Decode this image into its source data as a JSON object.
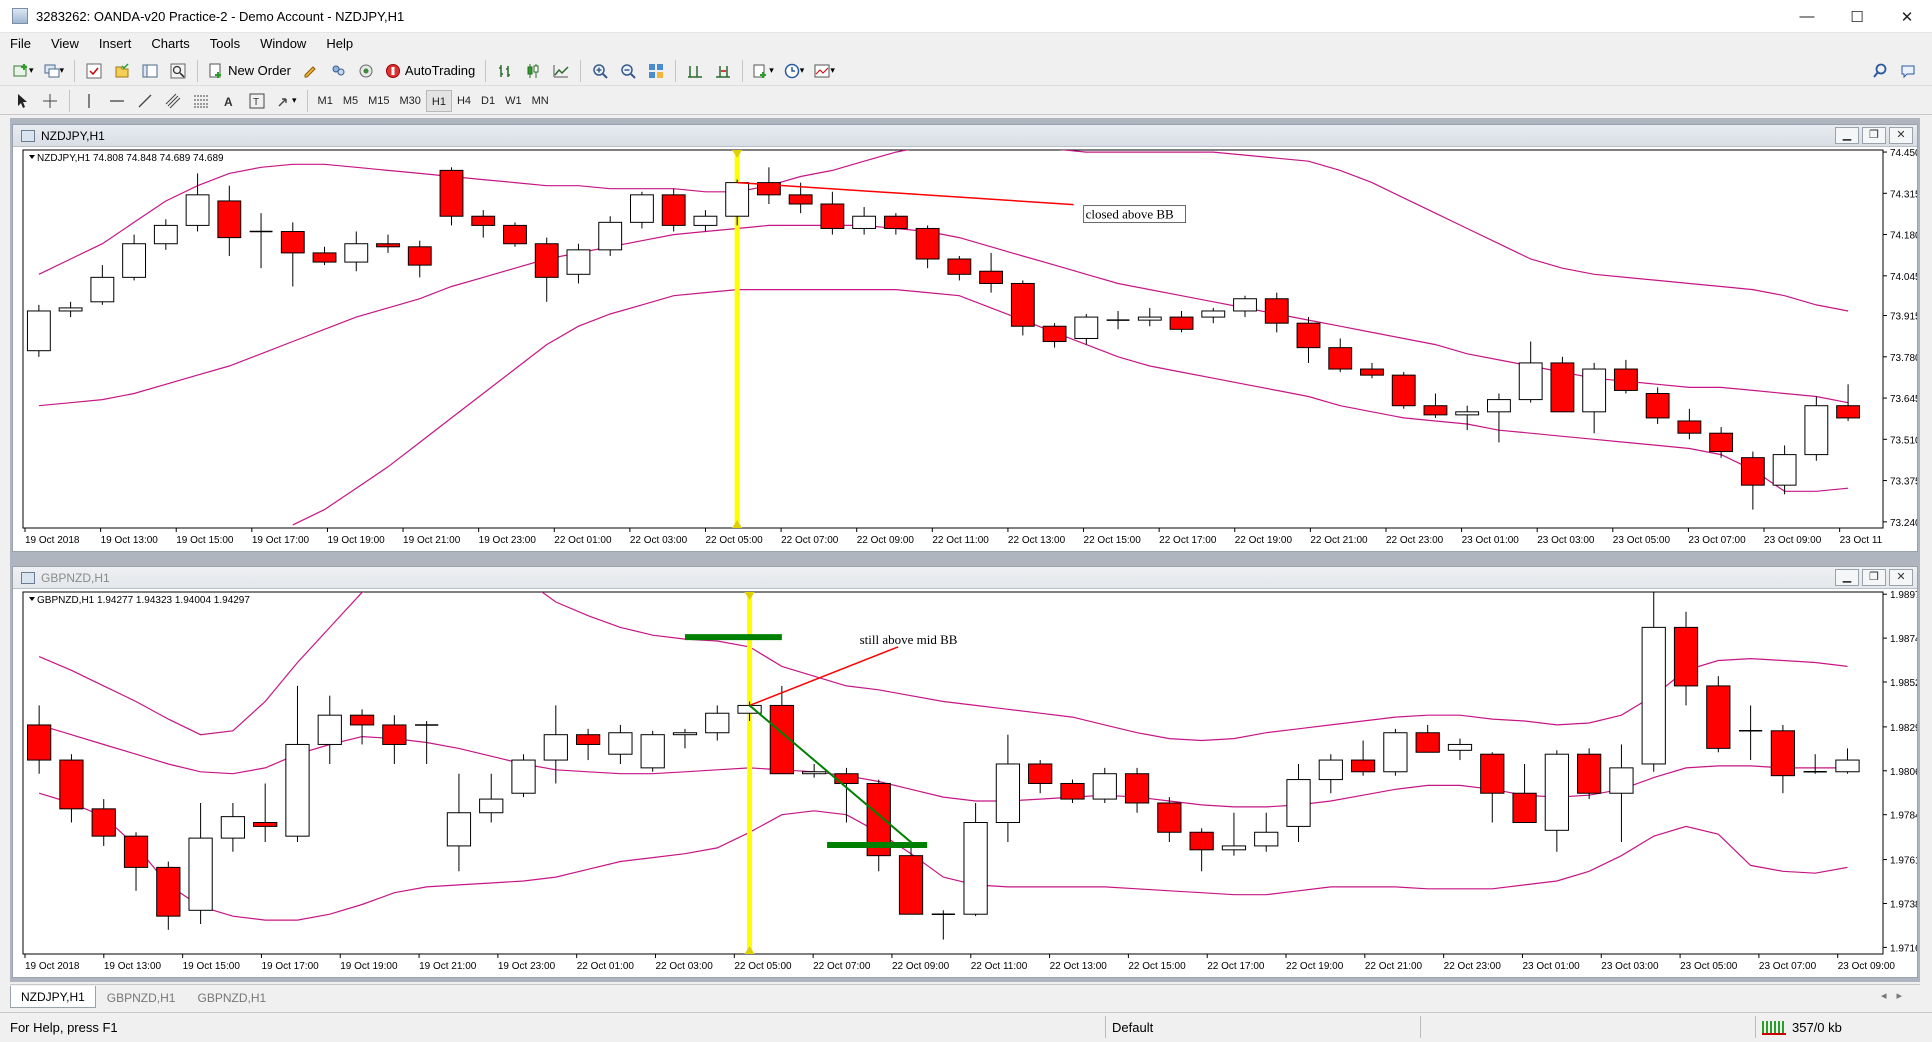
{
  "window": {
    "title": "3283262: OANDA-v20 Practice-2 - Demo Account - NZDJPY,H1",
    "minimize": "—",
    "maximize": "☐",
    "close": "✕"
  },
  "menu": [
    "File",
    "View",
    "Insert",
    "Charts",
    "Tools",
    "Window",
    "Help"
  ],
  "toolbar": {
    "new_order": "New Order",
    "autotrading": "AutoTrading"
  },
  "timeframes": [
    "M1",
    "M5",
    "M15",
    "M30",
    "H1",
    "H4",
    "D1",
    "W1",
    "MN"
  ],
  "active_timeframe": "H1",
  "colors": {
    "bear": "#ff0000",
    "bull": "#ffffff",
    "bands": "#c71585",
    "vline": "#ffff00",
    "annot_red": "#ff0000",
    "annot_green": "#008000"
  },
  "charts": [
    {
      "window_title": "NZDJPY,H1",
      "info": "NZDJPY,H1  74.808 74.848 74.689 74.689",
      "annotation": "closed above BB",
      "y_ticks": [
        "74.450",
        "74.315",
        "74.180",
        "74.045",
        "73.915",
        "73.780",
        "73.645",
        "73.510",
        "73.375",
        "73.240"
      ],
      "x_labels": [
        "19 Oct 2018",
        "19 Oct 13:00",
        "19 Oct 15:00",
        "19 Oct 17:00",
        "19 Oct 19:00",
        "19 Oct 21:00",
        "19 Oct 23:00",
        "22 Oct 01:00",
        "22 Oct 03:00",
        "22 Oct 05:00",
        "22 Oct 07:00",
        "22 Oct 09:00",
        "22 Oct 11:00",
        "22 Oct 13:00",
        "22 Oct 15:00",
        "22 Oct 17:00",
        "22 Oct 19:00",
        "22 Oct 21:00",
        "22 Oct 23:00",
        "23 Oct 01:00",
        "23 Oct 03:00",
        "23 Oct 05:00",
        "23 Oct 07:00",
        "23 Oct 09:00",
        "23 Oct 11"
      ],
      "candles": [
        [
          73.8,
          73.95,
          73.78,
          73.93
        ],
        [
          73.93,
          73.96,
          73.91,
          73.94
        ],
        [
          73.96,
          74.08,
          73.95,
          74.04
        ],
        [
          74.04,
          74.18,
          74.03,
          74.15
        ],
        [
          74.15,
          74.23,
          74.13,
          74.21
        ],
        [
          74.21,
          74.38,
          74.19,
          74.31
        ],
        [
          74.29,
          74.34,
          74.11,
          74.17
        ],
        [
          74.19,
          74.25,
          74.07,
          74.19
        ],
        [
          74.19,
          74.22,
          74.01,
          74.12
        ],
        [
          74.12,
          74.14,
          74.08,
          74.09
        ],
        [
          74.09,
          74.19,
          74.06,
          74.15
        ],
        [
          74.15,
          74.18,
          74.12,
          74.14
        ],
        [
          74.14,
          74.16,
          74.04,
          74.08
        ],
        [
          74.39,
          74.4,
          74.21,
          74.24
        ],
        [
          74.24,
          74.26,
          74.17,
          74.21
        ],
        [
          74.21,
          74.22,
          74.14,
          74.15
        ],
        [
          74.15,
          74.17,
          73.96,
          74.04
        ],
        [
          74.05,
          74.15,
          74.02,
          74.13
        ],
        [
          74.13,
          74.24,
          74.11,
          74.22
        ],
        [
          74.22,
          74.32,
          74.2,
          74.31
        ],
        [
          74.31,
          74.33,
          74.19,
          74.21
        ],
        [
          74.21,
          74.26,
          74.19,
          74.24
        ],
        [
          74.24,
          74.36,
          74.21,
          74.35
        ],
        [
          74.35,
          74.4,
          74.28,
          74.31
        ],
        [
          74.31,
          74.35,
          74.25,
          74.28
        ],
        [
          74.28,
          74.32,
          74.18,
          74.2
        ],
        [
          74.2,
          74.27,
          74.18,
          74.24
        ],
        [
          74.24,
          74.25,
          74.18,
          74.2
        ],
        [
          74.2,
          74.21,
          74.07,
          74.1
        ],
        [
          74.1,
          74.11,
          74.03,
          74.05
        ],
        [
          74.06,
          74.12,
          73.99,
          74.02
        ],
        [
          74.02,
          74.03,
          73.85,
          73.88
        ],
        [
          73.88,
          73.89,
          73.81,
          73.83
        ],
        [
          73.84,
          73.92,
          73.82,
          73.91
        ],
        [
          73.9,
          73.93,
          73.87,
          73.9
        ],
        [
          73.9,
          73.94,
          73.88,
          73.91
        ],
        [
          73.91,
          73.93,
          73.86,
          73.87
        ],
        [
          73.91,
          73.94,
          73.89,
          73.93
        ],
        [
          73.93,
          73.98,
          73.91,
          73.97
        ],
        [
          73.97,
          73.99,
          73.86,
          73.89
        ],
        [
          73.89,
          73.91,
          73.76,
          73.81
        ],
        [
          73.81,
          73.84,
          73.73,
          73.74
        ],
        [
          73.74,
          73.76,
          73.71,
          73.72
        ],
        [
          73.72,
          73.73,
          73.61,
          73.62
        ],
        [
          73.62,
          73.66,
          73.58,
          73.59
        ],
        [
          73.59,
          73.62,
          73.54,
          73.6
        ],
        [
          73.6,
          73.66,
          73.5,
          73.64
        ],
        [
          73.64,
          73.83,
          73.63,
          73.76
        ],
        [
          73.76,
          73.78,
          73.6,
          73.6
        ],
        [
          73.6,
          73.76,
          73.53,
          73.74
        ],
        [
          73.74,
          73.77,
          73.66,
          73.67
        ],
        [
          73.66,
          73.68,
          73.56,
          73.58
        ],
        [
          73.57,
          73.61,
          73.51,
          73.53
        ],
        [
          73.53,
          73.55,
          73.45,
          73.47
        ],
        [
          73.45,
          73.47,
          73.28,
          73.36
        ],
        [
          73.36,
          73.49,
          73.33,
          73.46
        ],
        [
          73.46,
          73.65,
          73.44,
          73.62
        ],
        [
          73.62,
          73.69,
          73.57,
          73.58
        ]
      ],
      "bb_upper": [
        74.05,
        74.1,
        74.15,
        74.22,
        74.29,
        74.34,
        74.38,
        74.4,
        74.41,
        74.41,
        74.4,
        74.39,
        74.38,
        74.37,
        74.36,
        74.35,
        74.34,
        74.34,
        74.33,
        74.33,
        74.33,
        74.32,
        74.32,
        74.34,
        74.37,
        74.39,
        74.42,
        74.45,
        74.47,
        74.47,
        74.47,
        74.47,
        74.46,
        74.45,
        74.45,
        74.45,
        74.45,
        74.45,
        74.44,
        74.43,
        74.42,
        74.39,
        74.35,
        74.3,
        74.25,
        74.2,
        74.15,
        74.1,
        74.07,
        74.05,
        74.04,
        74.03,
        74.02,
        74.01,
        74.0,
        73.98,
        73.95,
        73.93
      ],
      "bb_mid": [
        73.62,
        73.63,
        73.64,
        73.66,
        73.69,
        73.72,
        73.75,
        73.79,
        73.83,
        73.87,
        73.91,
        73.94,
        73.97,
        74.01,
        74.04,
        74.07,
        74.1,
        74.12,
        74.14,
        74.16,
        74.18,
        74.19,
        74.2,
        74.21,
        74.21,
        74.21,
        74.21,
        74.2,
        74.19,
        74.17,
        74.14,
        74.11,
        74.08,
        74.05,
        74.02,
        74.0,
        73.98,
        73.96,
        73.94,
        73.92,
        73.9,
        73.88,
        73.86,
        73.84,
        73.82,
        73.79,
        73.77,
        73.75,
        73.73,
        73.71,
        73.7,
        73.69,
        73.68,
        73.68,
        73.67,
        73.66,
        73.65,
        73.63
      ],
      "bb_lower": [
        null,
        null,
        null,
        null,
        null,
        null,
        null,
        null,
        73.23,
        73.28,
        73.35,
        73.42,
        73.5,
        73.58,
        73.66,
        73.74,
        73.82,
        73.88,
        73.92,
        73.95,
        73.98,
        73.99,
        74.0,
        74.0,
        74.0,
        74.0,
        74.0,
        74.0,
        73.99,
        73.98,
        73.94,
        73.9,
        73.86,
        73.82,
        73.78,
        73.75,
        73.73,
        73.71,
        73.69,
        73.67,
        73.65,
        73.62,
        73.6,
        73.58,
        73.57,
        73.56,
        73.54,
        73.53,
        73.52,
        73.51,
        73.5,
        73.49,
        73.48,
        73.46,
        73.41,
        73.34,
        73.34,
        73.35
      ],
      "marked_index": 22,
      "annot_line_from_index": 22,
      "annot_line_to_index": 32
    },
    {
      "window_title": "GBPNZD,H1",
      "info": "GBPNZD,H1  1.94277 1.94323 1.94004 1.94297",
      "annotation": "still above mid BB",
      "y_ticks": [
        "1.98970",
        "1.98745",
        "1.98520",
        "1.98290",
        "1.98065",
        "1.97840",
        "1.97610",
        "1.97385",
        "1.97160"
      ],
      "x_labels": [
        "19 Oct 2018",
        "19 Oct 13:00",
        "19 Oct 15:00",
        "19 Oct 17:00",
        "19 Oct 19:00",
        "19 Oct 21:00",
        "19 Oct 23:00",
        "22 Oct 01:00",
        "22 Oct 03:00",
        "22 Oct 05:00",
        "22 Oct 07:00",
        "22 Oct 09:00",
        "22 Oct 11:00",
        "22 Oct 13:00",
        "22 Oct 15:00",
        "22 Oct 17:00",
        "22 Oct 19:00",
        "22 Oct 21:00",
        "22 Oct 23:00",
        "23 Oct 01:00",
        "23 Oct 03:00",
        "23 Oct 05:00",
        "23 Oct 07:00",
        "23 Oct 09:00"
      ],
      "candles": [
        [
          1.983,
          1.984,
          1.9805,
          1.9812
        ],
        [
          1.9812,
          1.9815,
          1.978,
          1.9787
        ],
        [
          1.9787,
          1.9792,
          1.9768,
          1.9773
        ],
        [
          1.9773,
          1.9775,
          1.9745,
          1.9757
        ],
        [
          1.9757,
          1.976,
          1.9725,
          1.9732
        ],
        [
          1.9735,
          1.979,
          1.9728,
          1.9772
        ],
        [
          1.9772,
          1.979,
          1.9765,
          1.9783
        ],
        [
          1.978,
          1.98,
          1.977,
          1.9778
        ],
        [
          1.9773,
          1.985,
          1.977,
          1.982
        ],
        [
          1.982,
          1.9845,
          1.981,
          1.9835
        ],
        [
          1.9835,
          1.9838,
          1.982,
          1.983
        ],
        [
          1.983,
          1.9835,
          1.981,
          1.982
        ],
        [
          1.983,
          1.9832,
          1.981,
          1.983
        ],
        [
          1.9768,
          1.9805,
          1.9755,
          1.9785
        ],
        [
          1.9785,
          1.9805,
          1.978,
          1.9792
        ],
        [
          1.9795,
          1.9815,
          1.9793,
          1.9812
        ],
        [
          1.9812,
          1.984,
          1.98,
          1.9825
        ],
        [
          1.9825,
          1.9828,
          1.9812,
          1.982
        ],
        [
          1.9815,
          1.983,
          1.981,
          1.9826
        ],
        [
          1.9808,
          1.9827,
          1.9806,
          1.9825
        ],
        [
          1.9825,
          1.9828,
          1.9818,
          1.9826
        ],
        [
          1.9826,
          1.984,
          1.9822,
          1.9836
        ],
        [
          1.9836,
          1.9842,
          1.9832,
          1.984
        ],
        [
          1.984,
          1.985,
          1.9805,
          1.9805
        ],
        [
          1.9805,
          1.981,
          1.9803,
          1.9806
        ],
        [
          1.9805,
          1.9808,
          1.978,
          1.98
        ],
        [
          1.98,
          1.9802,
          1.9755,
          1.9763
        ],
        [
          1.9763,
          1.9768,
          1.9733,
          1.9733
        ],
        [
          1.9733,
          1.9735,
          1.972,
          1.9733
        ],
        [
          1.9733,
          1.979,
          1.9732,
          1.978
        ],
        [
          1.978,
          1.9825,
          1.977,
          1.981
        ],
        [
          1.981,
          1.9812,
          1.9795,
          1.98
        ],
        [
          1.98,
          1.9802,
          1.979,
          1.9792
        ],
        [
          1.9792,
          1.9808,
          1.979,
          1.9805
        ],
        [
          1.9805,
          1.9808,
          1.9785,
          1.979
        ],
        [
          1.979,
          1.9793,
          1.977,
          1.9775
        ],
        [
          1.9775,
          1.9777,
          1.9755,
          1.9766
        ],
        [
          1.9766,
          1.9785,
          1.9763,
          1.9768
        ],
        [
          1.9768,
          1.9785,
          1.9765,
          1.9775
        ],
        [
          1.9778,
          1.981,
          1.977,
          1.9802
        ],
        [
          1.9802,
          1.9815,
          1.9795,
          1.9812
        ],
        [
          1.9812,
          1.9822,
          1.9804,
          1.9806
        ],
        [
          1.9806,
          1.9828,
          1.9804,
          1.9826
        ],
        [
          1.9826,
          1.983,
          1.9816,
          1.9816
        ],
        [
          1.9817,
          1.9823,
          1.9812,
          1.982
        ],
        [
          1.9815,
          1.9816,
          1.978,
          1.9795
        ],
        [
          1.9795,
          1.981,
          1.978,
          1.978
        ],
        [
          1.9776,
          1.9817,
          1.9765,
          1.9815
        ],
        [
          1.9815,
          1.9818,
          1.9792,
          1.9795
        ],
        [
          1.9795,
          1.982,
          1.977,
          1.9808
        ],
        [
          1.981,
          1.99,
          1.9806,
          1.988
        ],
        [
          1.988,
          1.9888,
          1.984,
          1.985
        ],
        [
          1.985,
          1.9855,
          1.9816,
          1.9818
        ],
        [
          1.9827,
          1.984,
          1.9812,
          1.9827
        ],
        [
          1.9827,
          1.983,
          1.9795,
          1.9804
        ],
        [
          1.9806,
          1.9815,
          1.9805,
          1.9806
        ],
        [
          1.9806,
          1.9818,
          1.9805,
          1.9812
        ]
      ],
      "bb_upper": [
        1.9865,
        1.9858,
        1.985,
        1.9842,
        1.9833,
        1.9825,
        1.9827,
        1.9842,
        1.9862,
        1.988,
        1.9898,
        1.9905,
        1.991,
        1.9915,
        1.9912,
        1.9905,
        1.9893,
        1.9886,
        1.988,
        1.9876,
        1.9874,
        1.9873,
        1.987,
        1.986,
        1.9855,
        1.985,
        1.9848,
        1.9845,
        1.9842,
        1.984,
        1.9838,
        1.9836,
        1.9834,
        1.983,
        1.9826,
        1.9823,
        1.9822,
        1.9823,
        1.9826,
        1.9828,
        1.983,
        1.9832,
        1.9834,
        1.9835,
        1.9835,
        1.9833,
        1.9832,
        1.983,
        1.9831,
        1.9835,
        1.9845,
        1.9858,
        1.9863,
        1.9864,
        1.9863,
        1.9862,
        1.986
      ],
      "bb_mid": [
        1.983,
        1.9825,
        1.982,
        1.9815,
        1.981,
        1.9806,
        1.9805,
        1.9808,
        1.9815,
        1.982,
        1.9824,
        1.9823,
        1.9821,
        1.9818,
        1.9814,
        1.981,
        1.9807,
        1.9806,
        1.9805,
        1.9805,
        1.9806,
        1.9807,
        1.9808,
        1.9807,
        1.9806,
        1.9804,
        1.9801,
        1.9797,
        1.9793,
        1.9791,
        1.9791,
        1.9792,
        1.9793,
        1.9794,
        1.9793,
        1.9791,
        1.9789,
        1.9788,
        1.9788,
        1.9789,
        1.9791,
        1.9794,
        1.9797,
        1.9799,
        1.9799,
        1.9797,
        1.9794,
        1.9793,
        1.9794,
        1.9797,
        1.9803,
        1.9808,
        1.9809,
        1.9809,
        1.9808,
        1.9808,
        1.9808
      ],
      "bb_lower": [
        1.9795,
        1.979,
        1.9783,
        1.9768,
        1.9748,
        1.9737,
        1.9732,
        1.973,
        1.973,
        1.9733,
        1.9738,
        1.9744,
        1.9747,
        1.9748,
        1.9749,
        1.975,
        1.9752,
        1.9756,
        1.976,
        1.9762,
        1.9764,
        1.9767,
        1.9775,
        1.9784,
        1.9786,
        1.9784,
        1.9775,
        1.9764,
        1.9752,
        1.9748,
        1.9747,
        1.9747,
        1.9747,
        1.9747,
        1.9746,
        1.9745,
        1.9744,
        1.9743,
        1.9743,
        1.9745,
        1.9747,
        1.9747,
        1.9747,
        1.9746,
        1.9746,
        1.9746,
        1.9748,
        1.975,
        1.9755,
        1.9763,
        1.9773,
        1.9778,
        1.9774,
        1.9758,
        1.9755,
        1.9754,
        1.9757
      ],
      "marked_index": 22,
      "annot_line_from_index": 22,
      "annot_line_to_index": 26,
      "green_line_from_index": 22,
      "green_line_to_index": 27,
      "green_mark_top_index": 22,
      "green_mark_top_price": 1.9875,
      "green_mark_bottom_index": 27,
      "green_mark_bottom_price": 1.97685
    }
  ],
  "tabs": [
    "NZDJPY,H1",
    "GBPNZD,H1",
    "GBPNZD,H1"
  ],
  "status": {
    "help": "For Help, press F1",
    "profile": "Default",
    "traffic": "357/0 kb"
  }
}
